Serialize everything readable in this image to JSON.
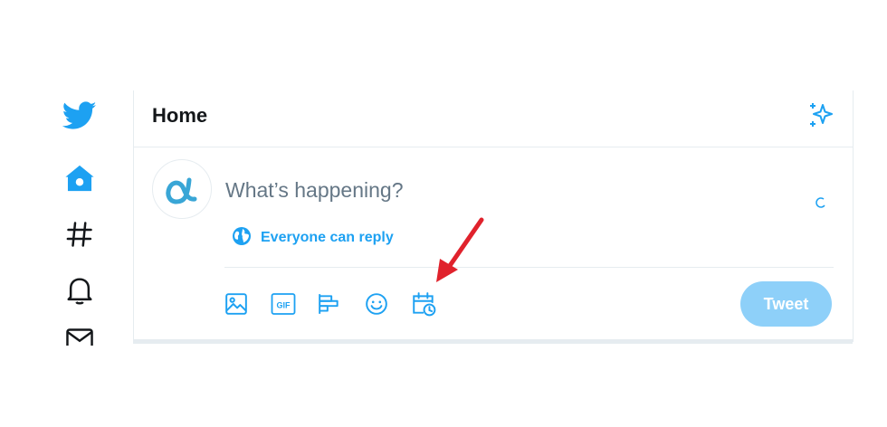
{
  "sidebar": {
    "items": [
      {
        "icon": "twitter-bird-icon"
      },
      {
        "icon": "home-icon"
      },
      {
        "icon": "explore-hashtag-icon"
      },
      {
        "icon": "notifications-bell-icon"
      },
      {
        "icon": "messages-envelope-icon"
      }
    ]
  },
  "header": {
    "title": "Home",
    "icon": "sparkle-icon"
  },
  "composer": {
    "placeholder": "What’s happening?",
    "reply_setting": "Everyone can reply",
    "tools": [
      "media-icon",
      "gif-icon",
      "poll-icon",
      "emoji-icon",
      "schedule-icon"
    ],
    "gif_label": "GIF",
    "tweet_label": "Tweet"
  },
  "colors": {
    "brand": "#1da1f2",
    "tweet_disabled": "#8ed0f9",
    "annotation_arrow": "#e0222c"
  }
}
